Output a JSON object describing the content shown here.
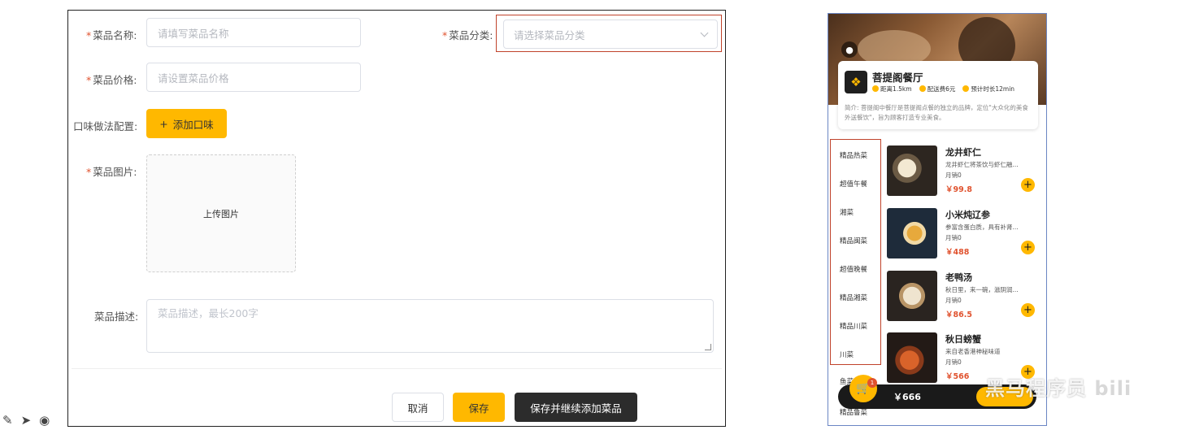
{
  "form": {
    "name_label": "菜品名称:",
    "name_placeholder": "请填写菜品名称",
    "category_label": "菜品分类:",
    "category_placeholder": "请选择菜品分类",
    "price_label": "菜品价格:",
    "price_placeholder": "请设置菜品价格",
    "flavor_label": "口味做法配置:",
    "add_flavor_button": "添加口味",
    "image_label": "菜品图片:",
    "upload_text": "上传图片",
    "desc_label": "菜品描述:",
    "desc_placeholder": "菜品描述，最长200字",
    "required_mark": "*",
    "actions": {
      "cancel": "取消",
      "save": "保存",
      "save_continue": "保存并继续添加菜品"
    }
  },
  "preview": {
    "shop": {
      "name": "菩提阁餐厅",
      "distance": "距离1.5km",
      "delivery_fee": "配送费6元",
      "eta": "预计时长12min",
      "description": "简介: 菩提阁中餐厅是菩提阁点餐的独立的品牌，定位\"大众化的美食外送餐饮\"，旨为顾客打造专业美食。"
    },
    "categories": [
      "精品热菜",
      "超值午餐",
      "湘菜",
      "精品闽菜",
      "超值晚餐",
      "精品湘菜",
      "精品川菜",
      "川菜"
    ],
    "dishes": [
      {
        "name": "龙井虾仁",
        "desc": "龙井虾仁将茶饮与虾仁融...",
        "sales": "月销0",
        "price": "￥99.8"
      },
      {
        "name": "小米炖辽参",
        "desc": "参富含蛋白质，具有补肾...",
        "sales": "月销0",
        "price": "￥488"
      },
      {
        "name": "老鸭汤",
        "desc": "秋日里，来一碗，滋阴润...",
        "sales": "月销0",
        "price": "￥86.5"
      },
      {
        "name": "秋日螃蟹",
        "desc": "来自老香港神秘味道",
        "sales": "月销0",
        "price": "￥566"
      }
    ],
    "cart": {
      "badge": "1",
      "total": "￥666"
    },
    "peek_category_1": "鱼菜",
    "peek_category_2": "精品鲁菜"
  },
  "watermark": {
    "text": "黑马程序员",
    "extra": "bili"
  },
  "colors": {
    "accent": "#ffb800",
    "highlight_box": "#c0432b",
    "price": "#e0522e",
    "dark_button": "#2c2c2c"
  }
}
